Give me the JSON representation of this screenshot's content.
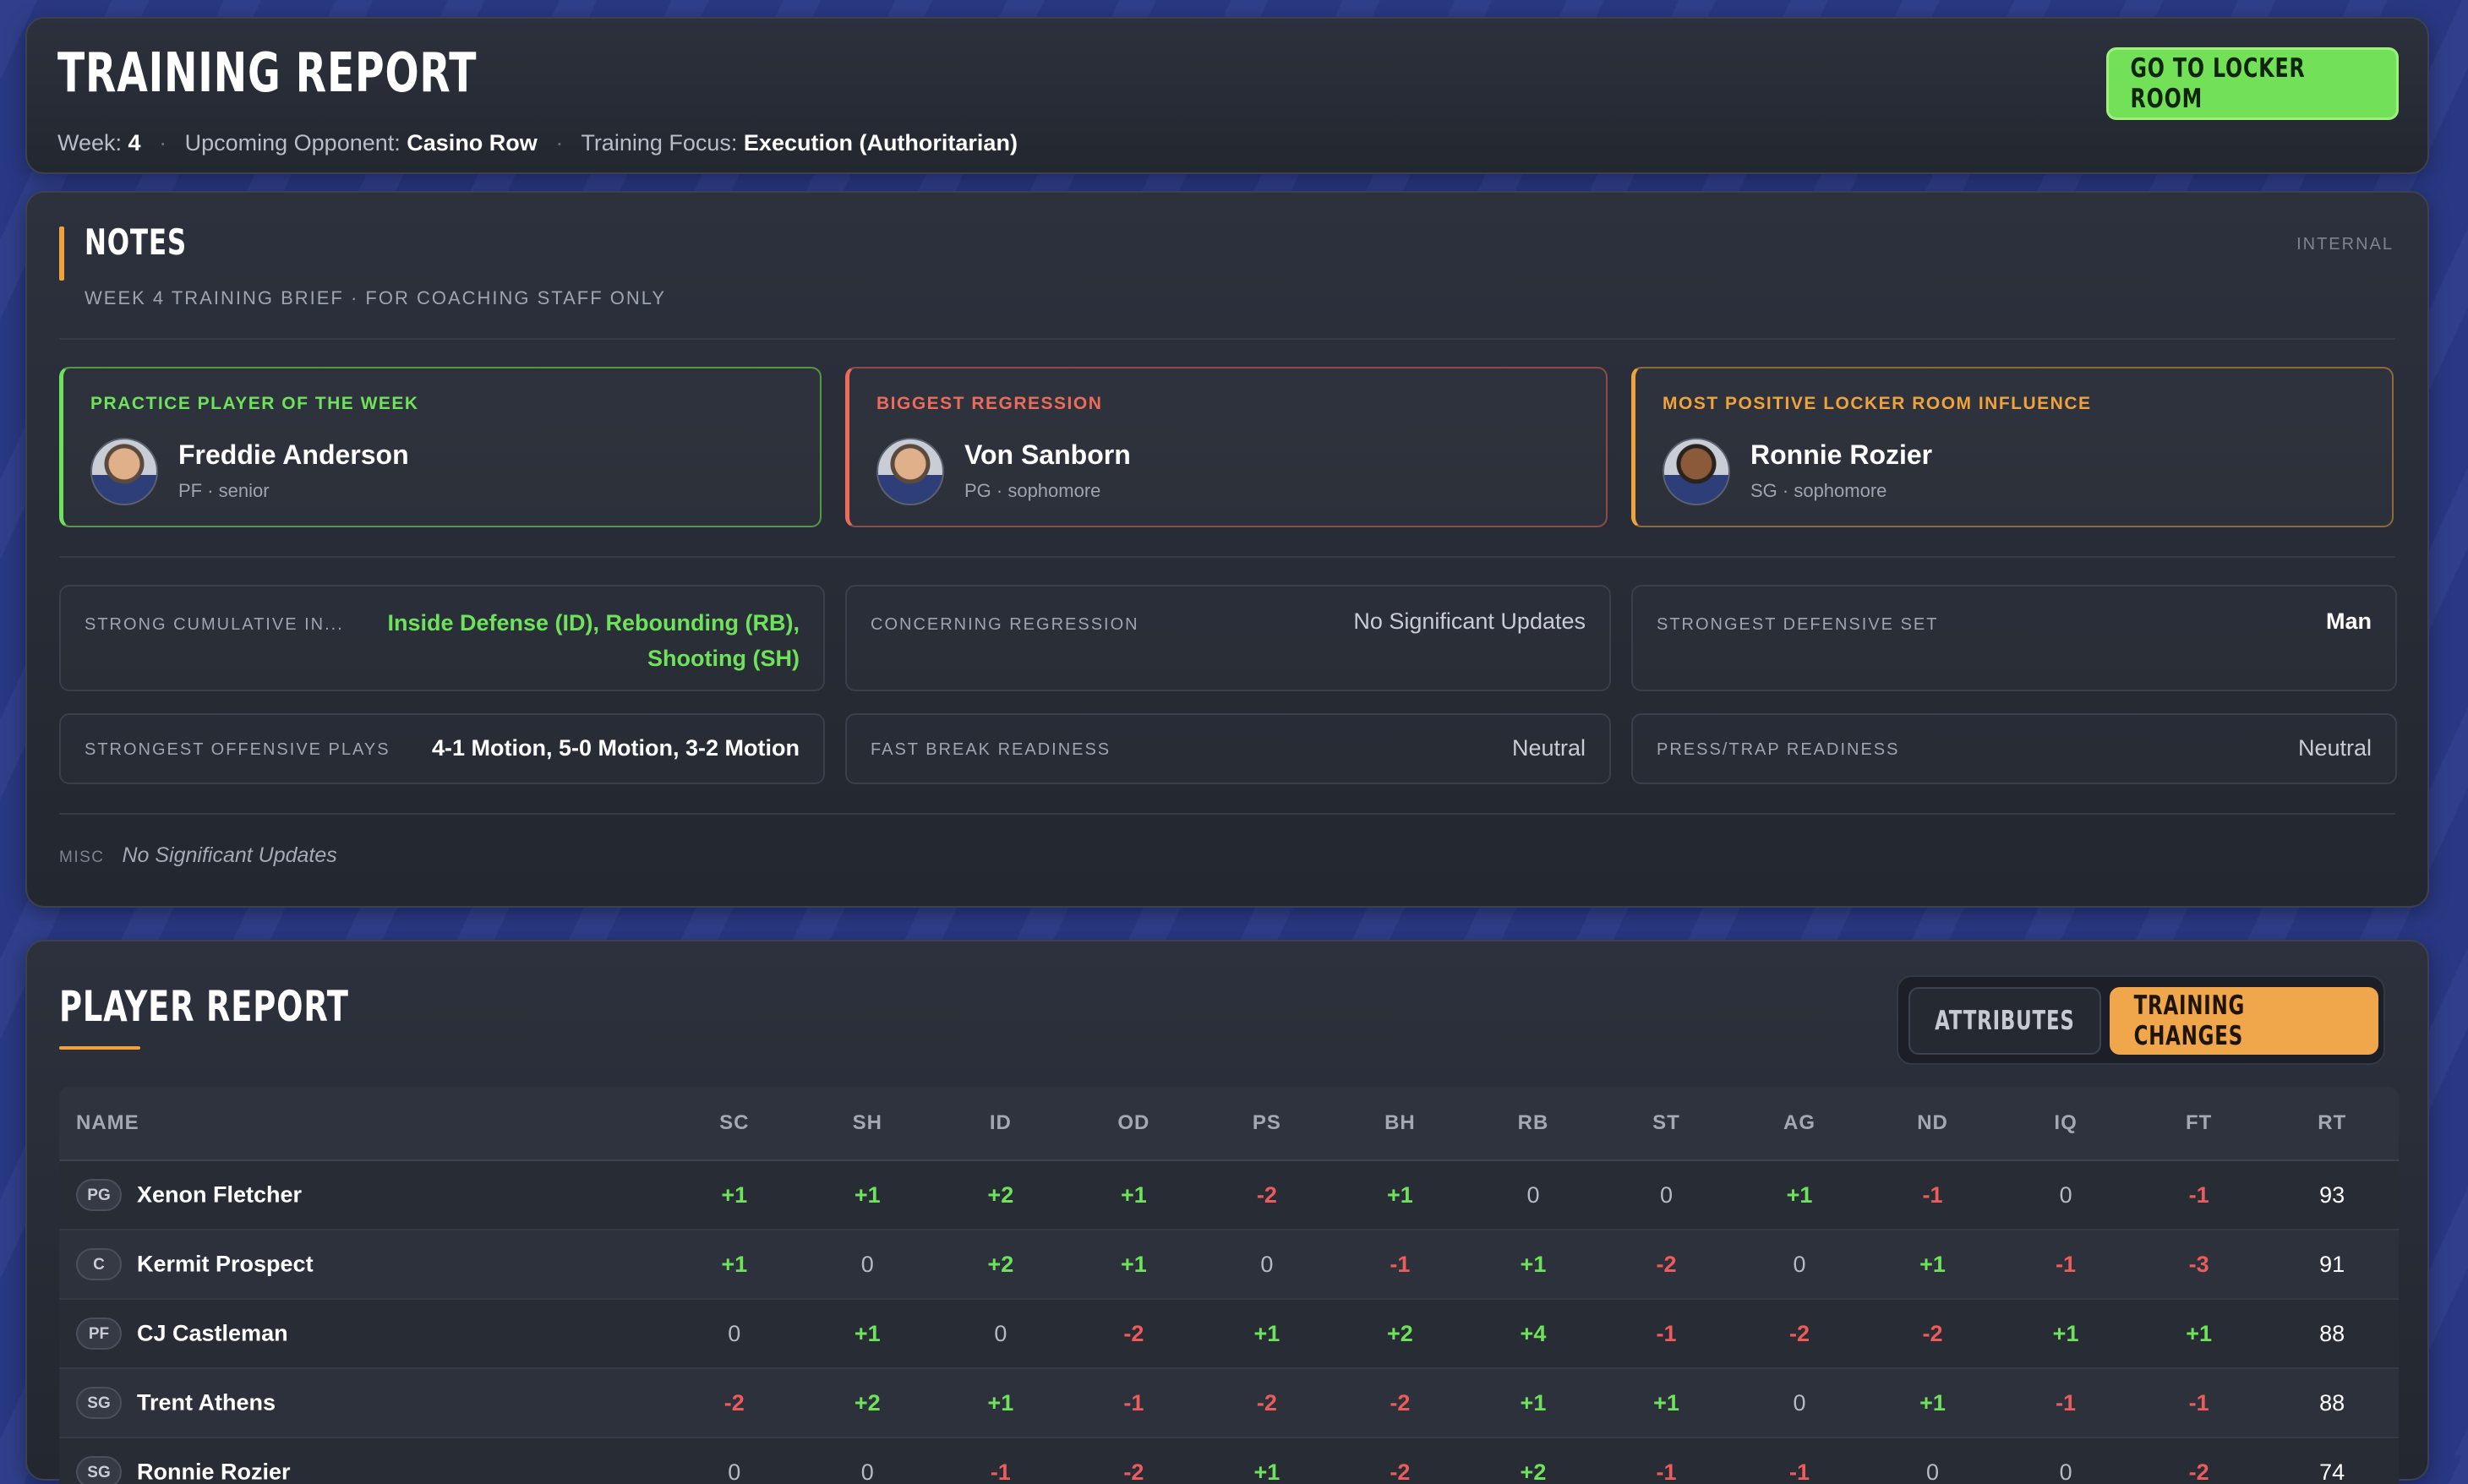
{
  "header": {
    "title": "Training Report",
    "week_label": "Week:",
    "week": "4",
    "opponent_label": "Upcoming Opponent:",
    "opponent": "Casino Row",
    "focus_label": "Training Focus:",
    "focus": "Execution (Authoritarian)",
    "locker_button": "Go to Locker Room"
  },
  "notes": {
    "title": "Notes",
    "subtitle": "WEEK 4 TRAINING BRIEF · FOR COACHING STAFF ONLY",
    "tag": "INTERNAL",
    "awards": [
      {
        "label": "PRACTICE PLAYER OF THE WEEK",
        "name": "Freddie Anderson",
        "info": "PF · senior",
        "color": "#6ee25a"
      },
      {
        "label": "BIGGEST REGRESSION",
        "name": "Von Sanborn",
        "info": "PG · sophomore",
        "color": "#ee6b5b"
      },
      {
        "label": "MOST POSITIVE LOCKER ROOM INFLUENCE",
        "name": "Ronnie Rozier",
        "info": "SG · sophomore",
        "color": "#f0a33b"
      }
    ],
    "stats": [
      {
        "label": "STRONG CUMULATIVE IN...",
        "value_line1": "Inside Defense (ID), Rebounding (RB),",
        "value_line2": "Shooting (SH)"
      },
      {
        "label": "CONCERNING REGRESSION",
        "value": "No Significant Updates"
      },
      {
        "label": "STRONGEST DEFENSIVE SET",
        "value": "Man"
      },
      {
        "label": "STRONGEST OFFENSIVE PLAYS",
        "value": "4-1 Motion, 5-0 Motion, 3-2 Motion"
      },
      {
        "label": "FAST BREAK READINESS",
        "value": "Neutral"
      },
      {
        "label": "PRESS/TRAP READINESS",
        "value": "Neutral"
      }
    ],
    "misc_label": "MISC",
    "misc_value": "No Significant Updates"
  },
  "player_report": {
    "title": "Player Report",
    "toggle_attributes": "Attributes",
    "toggle_training": "Training Changes",
    "columns": [
      "NAME",
      "SC",
      "SH",
      "ID",
      "OD",
      "PS",
      "BH",
      "RB",
      "ST",
      "AG",
      "ND",
      "IQ",
      "FT",
      "RT"
    ],
    "rows": [
      {
        "pos": "PG",
        "name": "Xenon Fletcher",
        "vals": [
          "+1",
          "+1",
          "+2",
          "+1",
          "-2",
          "+1",
          "0",
          "0",
          "+1",
          "-1",
          "0",
          "-1"
        ],
        "rt": "93"
      },
      {
        "pos": "C",
        "name": "Kermit Prospect",
        "vals": [
          "+1",
          "0",
          "+2",
          "+1",
          "0",
          "-1",
          "+1",
          "-2",
          "0",
          "+1",
          "-1",
          "-3"
        ],
        "rt": "91"
      },
      {
        "pos": "PF",
        "name": "CJ Castleman",
        "vals": [
          "0",
          "+1",
          "0",
          "-2",
          "+1",
          "+2",
          "+4",
          "-1",
          "-2",
          "-2",
          "+1",
          "+1"
        ],
        "rt": "88"
      },
      {
        "pos": "SG",
        "name": "Trent Athens",
        "vals": [
          "-2",
          "+2",
          "+1",
          "-1",
          "-2",
          "-2",
          "+1",
          "+1",
          "0",
          "+1",
          "-1",
          "-1"
        ],
        "rt": "88"
      },
      {
        "pos": "SG",
        "name": "Ronnie Rozier",
        "vals": [
          "0",
          "0",
          "-1",
          "-2",
          "+1",
          "-2",
          "+2",
          "-1",
          "-1",
          "0",
          "0",
          "-2"
        ],
        "rt": "74"
      }
    ]
  }
}
